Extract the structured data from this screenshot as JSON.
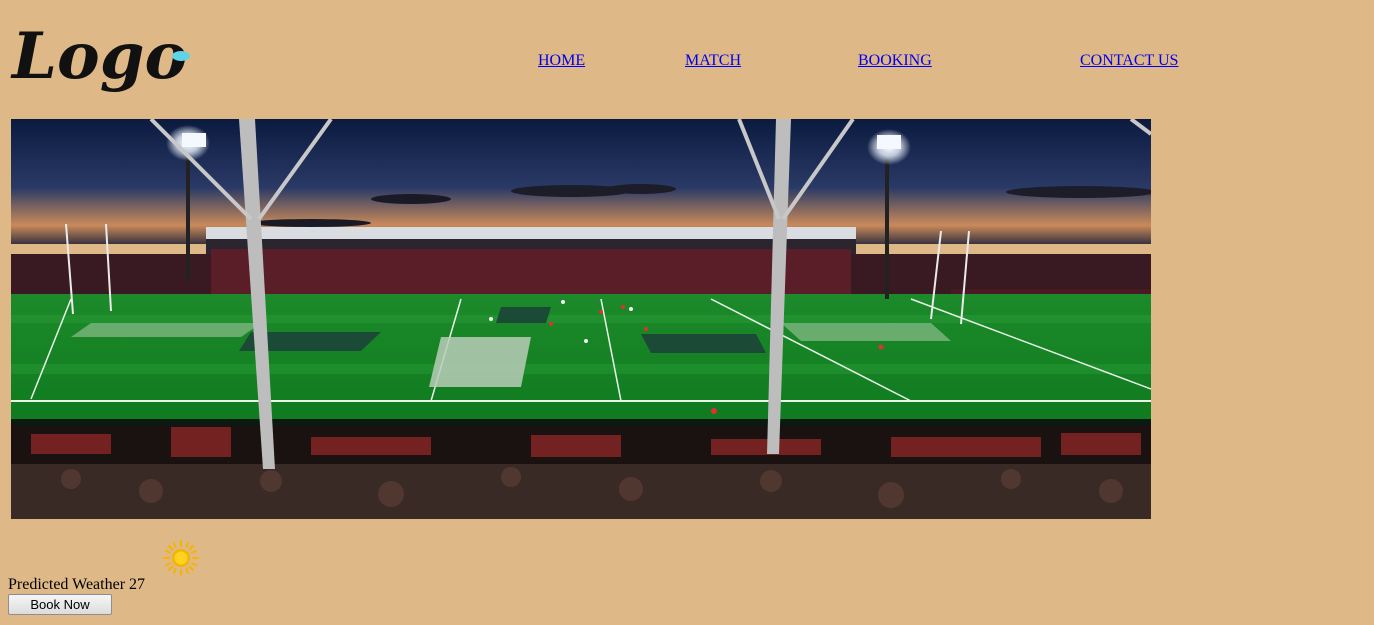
{
  "header": {
    "logo_text": "Logo",
    "nav": {
      "home": "HOME",
      "match": "MATCH",
      "booking": "BOOKING",
      "contact": "CONTACT US"
    }
  },
  "hero": {
    "icon": "stadium-image"
  },
  "weather": {
    "label": "Predicted Weather 27",
    "icon": "sun-icon"
  },
  "actions": {
    "book_label": "Book Now"
  },
  "colors": {
    "page_bg": "#deb887",
    "link": "#0000ee",
    "logo_dot": "#5fd3e8"
  }
}
